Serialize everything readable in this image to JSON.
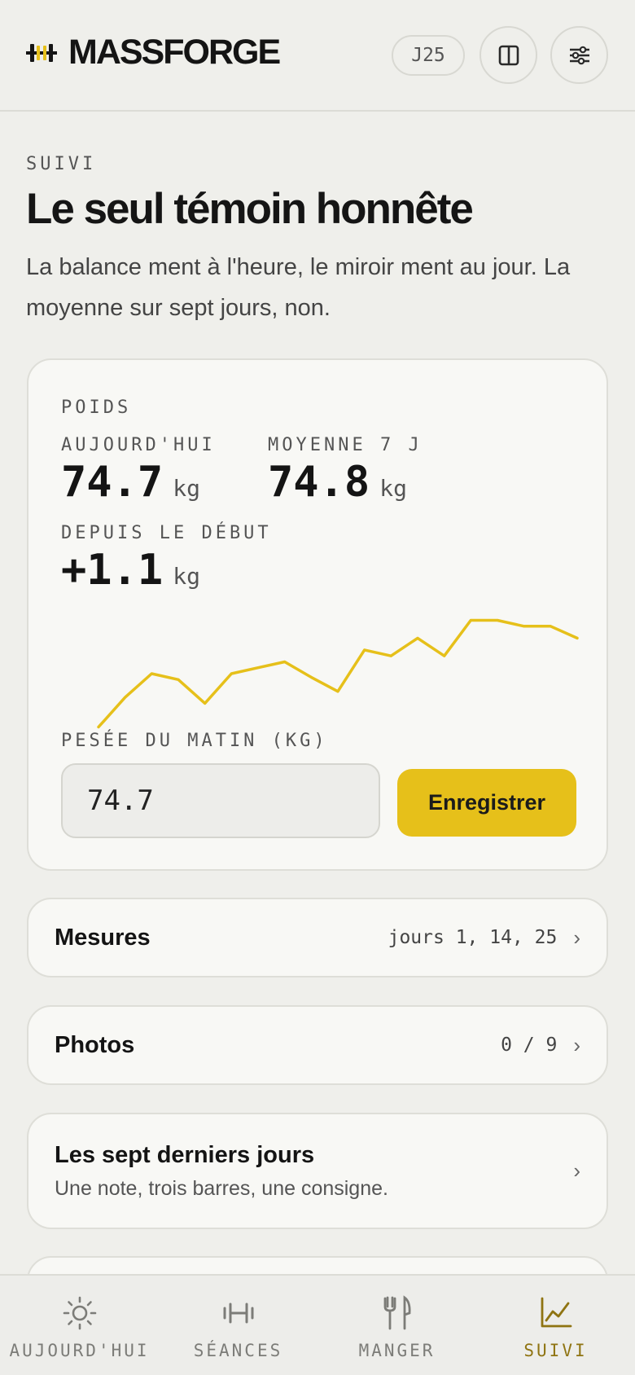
{
  "header": {
    "brand": "MASSFORGE",
    "day_badge": "J25",
    "book_icon": "book-columns-icon",
    "settings_icon": "sliders-icon"
  },
  "intro": {
    "eyebrow": "SUIVI",
    "title": "Le seul témoin honnête",
    "subtitle": "La balance ment à l'heure, le miroir ment au jour. La moyenne sur sept jours, non."
  },
  "weight_card": {
    "section_label": "POIDS",
    "today_label": "AUJOURD'HUI",
    "today_value": "74.7",
    "avg_label": "MOYENNE 7 J",
    "avg_value": "74.8",
    "since_label": "DEPUIS LE DÉBUT",
    "since_value": "+1.1",
    "unit": "kg",
    "input_label": "PESÉE DU MATIN (KG)",
    "input_value": "74.7",
    "save_label": "Enregistrer",
    "accent": "#e6c01a"
  },
  "chart_data": {
    "type": "line",
    "x": [
      1,
      2,
      3,
      4,
      5,
      6,
      7,
      8,
      9,
      10,
      11,
      12,
      13,
      14,
      15,
      16,
      17,
      18,
      19
    ],
    "values": [
      73.6,
      73.85,
      74.05,
      74.0,
      73.8,
      74.05,
      74.1,
      74.15,
      74.02,
      73.9,
      74.25,
      74.2,
      74.35,
      74.2,
      74.5,
      74.5,
      74.45,
      74.45,
      74.35
    ],
    "ylim": [
      73.5,
      74.6
    ],
    "color": "#e6c01a",
    "grid": false,
    "title": "",
    "xlabel": "",
    "ylabel": ""
  },
  "rows": {
    "mesures": {
      "title": "Mesures",
      "meta": "jours 1, 14, 25"
    },
    "photos": {
      "title": "Photos",
      "meta": "0 / 9"
    },
    "week": {
      "title": "Les sept derniers jours",
      "subtitle": "Une note, trois barres, une consigne."
    },
    "chevron": "›"
  },
  "nav": {
    "items": [
      {
        "label": "AUJOURD'HUI",
        "icon": "sun-icon"
      },
      {
        "label": "SÉANCES",
        "icon": "dumbbell-icon"
      },
      {
        "label": "MANGER",
        "icon": "fork-knife-icon"
      },
      {
        "label": "SUIVI",
        "icon": "chart-icon",
        "active": true
      }
    ],
    "active_color": "#8f7412"
  }
}
